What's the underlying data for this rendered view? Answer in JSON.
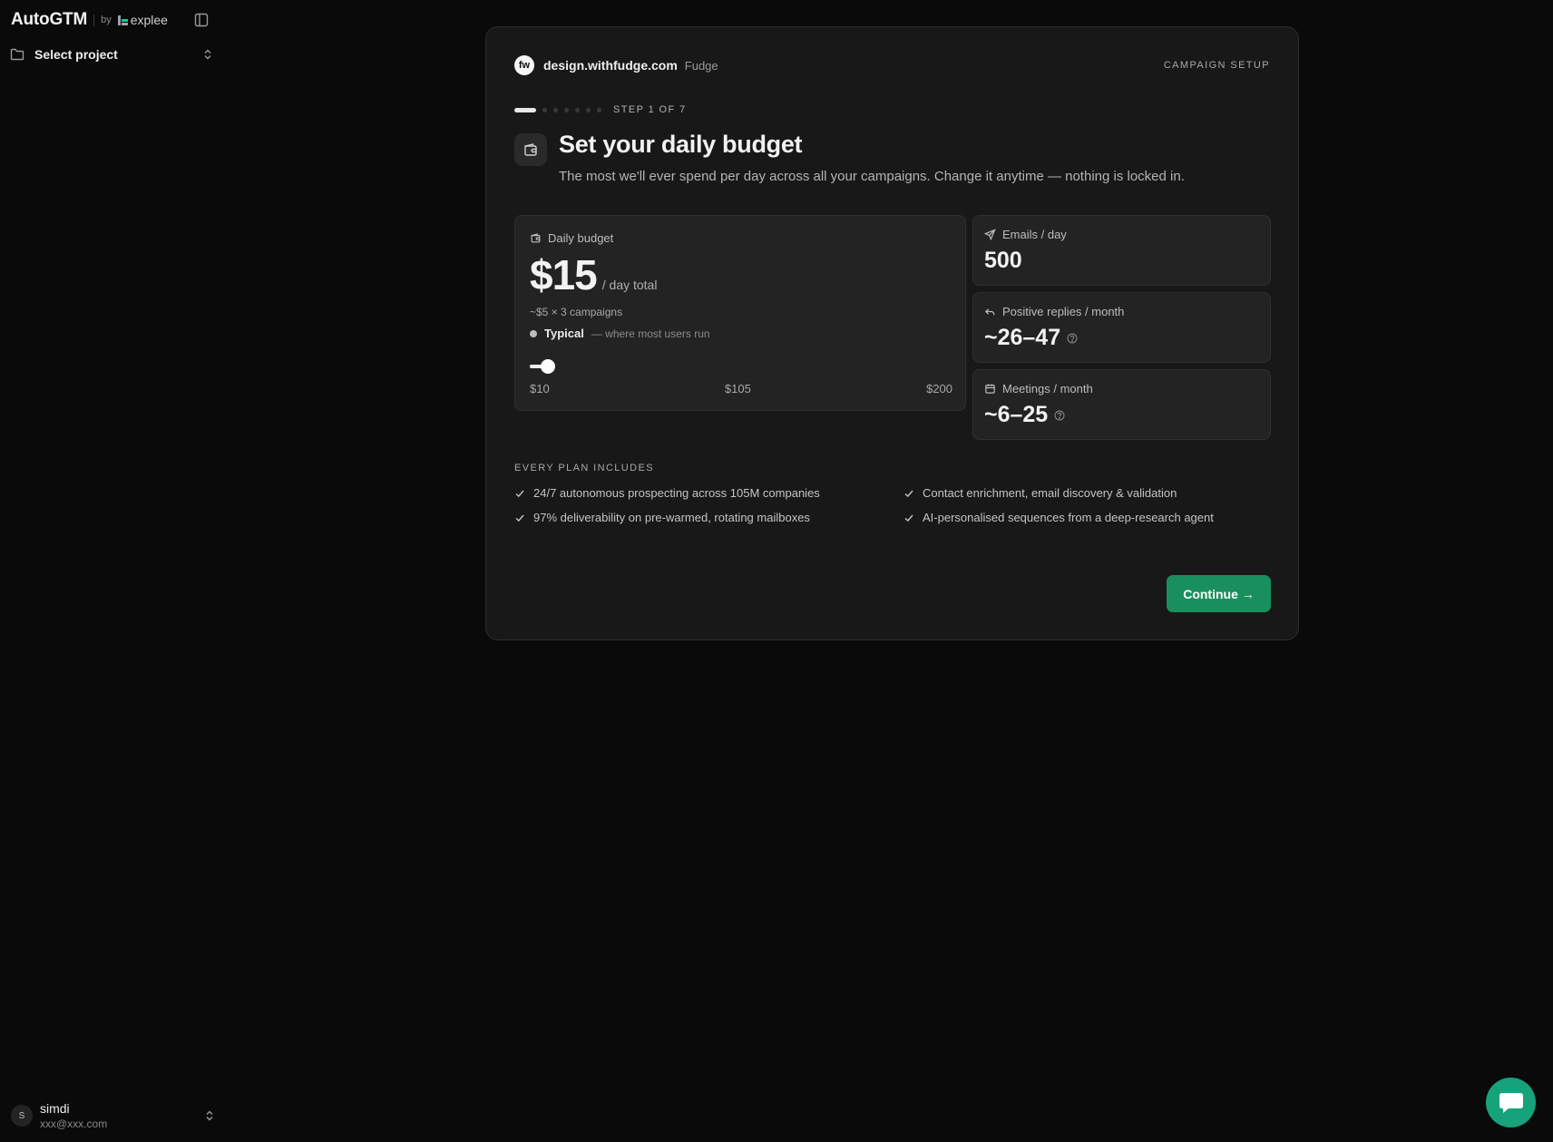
{
  "brand": {
    "name": "AutoGTM",
    "by": "by",
    "partner": "explee"
  },
  "sidebar": {
    "project_select_label": "Select project"
  },
  "user": {
    "initial": "S",
    "name": "simdi",
    "email": "xxx@xxx.com"
  },
  "card": {
    "site_logo_text": "fw",
    "site_domain": "design.withfudge.com",
    "site_name": "Fudge",
    "setup_label": "CAMPAIGN SETUP",
    "progress": {
      "current_step": 1,
      "total_steps": 7,
      "label": "STEP 1 OF 7"
    },
    "title": "Set your daily budget",
    "subtitle": "The most we'll ever spend per day across all your campaigns. Change it anytime — nothing is locked in.",
    "budget": {
      "label": "Daily budget",
      "amount": "$15",
      "unit": "/ day total",
      "breakdown": "~$5 × 3 campaigns",
      "tier_name": "Typical",
      "tier_note": "— where most users run",
      "slider": {
        "min": 10,
        "max": 200,
        "value": 15,
        "tick_labels": [
          "$10",
          "$105",
          "$200"
        ]
      }
    },
    "metrics": [
      {
        "label": "Emails / day",
        "value": "500",
        "icon": "send-icon",
        "has_help": false
      },
      {
        "label": "Positive replies / month",
        "value": "~26–47",
        "icon": "reply-icon",
        "has_help": true
      },
      {
        "label": "Meetings / month",
        "value": "~6–25",
        "icon": "calendar-icon",
        "has_help": true
      }
    ],
    "includes": {
      "title": "EVERY PLAN INCLUDES",
      "items": [
        "24/7 autonomous prospecting across 105M companies",
        "Contact enrichment, email discovery & validation",
        "97% deliverability on pre-warmed, rotating mailboxes",
        "AI-personalised sequences from a deep-research agent"
      ]
    },
    "continue_label": "Continue →"
  },
  "colors": {
    "accent": "#1a8f5e",
    "chat": "#16a27a",
    "background": "#0a0a0a",
    "card": "#181818"
  }
}
